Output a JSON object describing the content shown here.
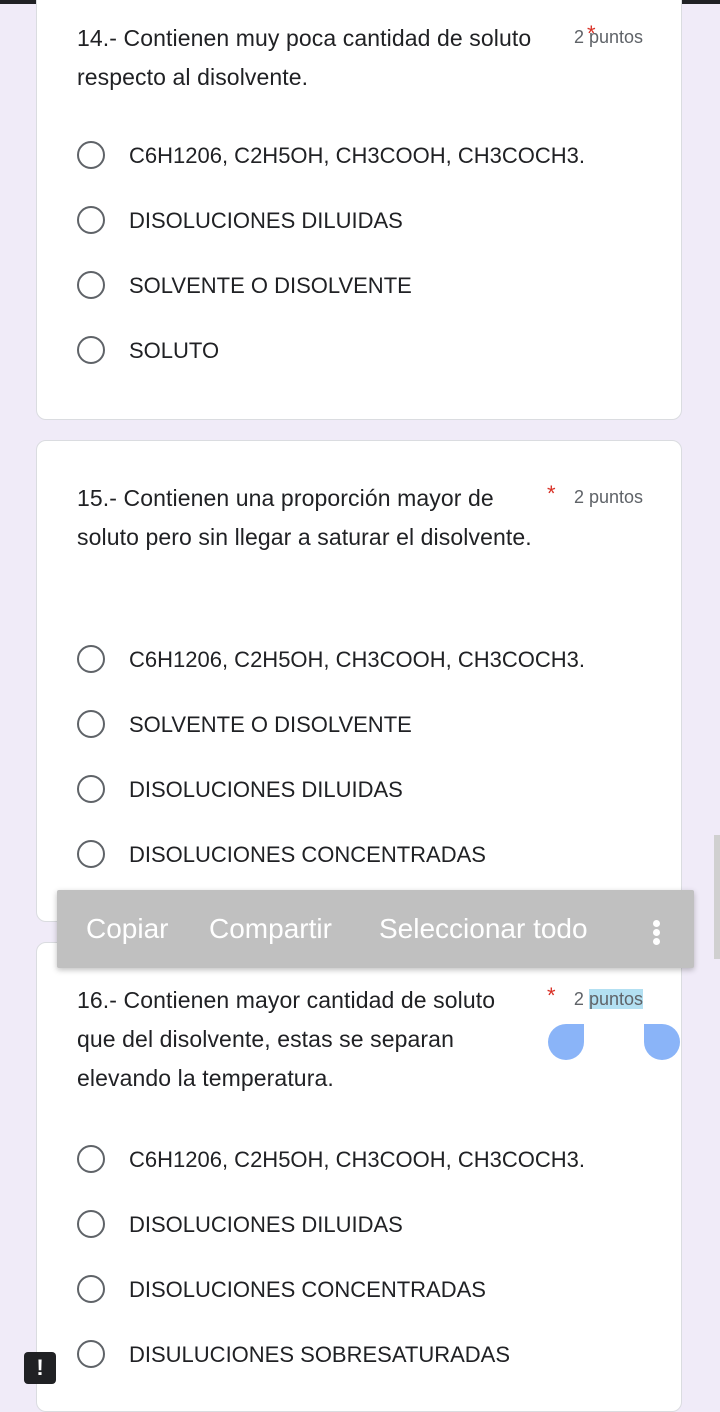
{
  "questions": [
    {
      "title": "14.- Contienen muy poca cantidad de soluto respecto al disolvente.",
      "required": "*",
      "points": "2 puntos",
      "options": [
        "C6H1206, C2H5OH, CH3COOH, CH3COCH3.",
        "DISOLUCIONES DILUIDAS",
        "SOLVENTE O DISOLVENTE",
        "SOLUTO"
      ]
    },
    {
      "title": "15.- Contienen una proporción mayor de soluto pero sin llegar a saturar el disolvente.",
      "required": "*",
      "points": "2 puntos",
      "options": [
        "C6H1206, C2H5OH, CH3COOH, CH3COCH3.",
        "SOLVENTE O DISOLVENTE",
        "DISOLUCIONES DILUIDAS",
        "DISOLUCIONES CONCENTRADAS"
      ]
    },
    {
      "title": "16.- Contienen mayor cantidad de soluto que del disolvente, estas se separan elevando la temperatura.",
      "required": "*",
      "points_number": "2",
      "points_word": "puntos",
      "options": [
        "C6H1206, C2H5OH, CH3COOH, CH3COCH3.",
        "DISOLUCIONES DILUIDAS",
        "DISOLUCIONES CONCENTRADAS",
        "DISULUCIONES SOBRESATURADAS"
      ]
    }
  ],
  "context_menu": {
    "copy": "Copiar",
    "share": "Compartir",
    "select_all": "Seleccionar todo",
    "more_icon": "more-vert-icon"
  },
  "alert_icon": {
    "icon": "alert-icon",
    "glyph": "!"
  },
  "colors": {
    "background": "#f0ebf8",
    "required": "#d93025",
    "menu": "#c0c0c0",
    "selection": "#b3e0f2",
    "handle": "#8ab4f8"
  }
}
